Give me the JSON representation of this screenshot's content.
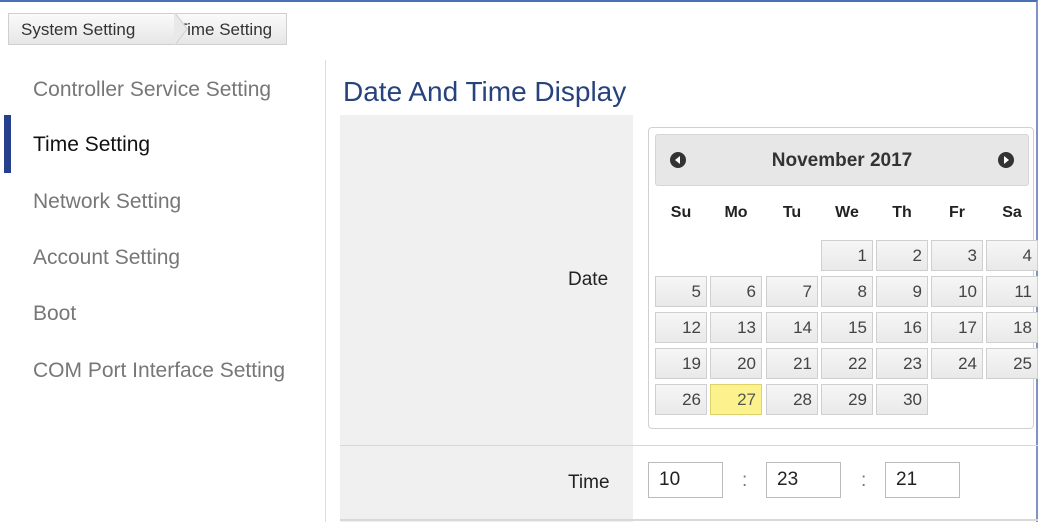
{
  "breadcrumb": [
    "System Setting",
    "Time Setting"
  ],
  "sidebar": {
    "items": [
      {
        "label": "Controller Service Setting"
      },
      {
        "label": "Time Setting",
        "active": true
      },
      {
        "label": "Network Setting"
      },
      {
        "label": "Account Setting"
      },
      {
        "label": "Boot"
      },
      {
        "label": "COM Port Interface Setting"
      }
    ]
  },
  "main": {
    "title": "Date And Time Display",
    "date_label": "Date",
    "time_label": "Time"
  },
  "calendar": {
    "title": "November 2017",
    "prev_icon": "circle-arrow-left-icon",
    "next_icon": "circle-arrow-right-icon",
    "weekdays": [
      "Su",
      "Mo",
      "Tu",
      "We",
      "Th",
      "Fr",
      "Sa"
    ],
    "weeks": [
      [
        "",
        "",
        "",
        "1",
        "2",
        "3",
        "4"
      ],
      [
        "5",
        "6",
        "7",
        "8",
        "9",
        "10",
        "11"
      ],
      [
        "12",
        "13",
        "14",
        "15",
        "16",
        "17",
        "18"
      ],
      [
        "19",
        "20",
        "21",
        "22",
        "23",
        "24",
        "25"
      ],
      [
        "26",
        "27",
        "28",
        "29",
        "30",
        "",
        ""
      ]
    ],
    "highlighted_day": "27",
    "highlight_color": "#fbf28e"
  },
  "time": {
    "hour": "10",
    "minute": "23",
    "second": "21",
    "separator": ":"
  },
  "colors": {
    "accent": "#26408c",
    "title": "#27427c",
    "frame": "#4a6fb5"
  }
}
